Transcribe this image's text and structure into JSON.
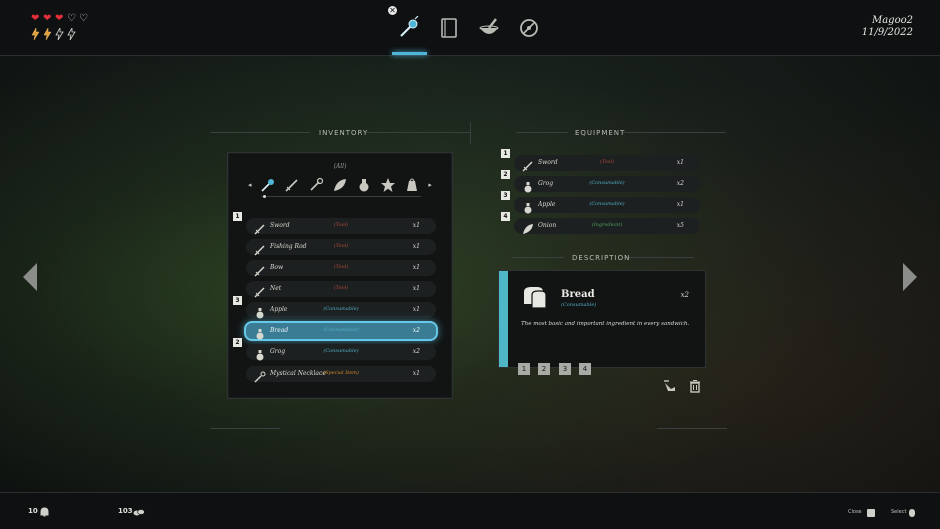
{
  "player": {
    "name": "Magoo2",
    "date": "11/9/2022"
  },
  "hud": {
    "hearts": [
      "full",
      "full",
      "full",
      "empty",
      "empty"
    ],
    "energy": [
      "full",
      "full",
      "empty",
      "empty"
    ]
  },
  "tabs": [
    {
      "id": "inventory",
      "icon": "potion-wand-icon",
      "active": true
    },
    {
      "id": "journal",
      "icon": "book-icon",
      "active": false
    },
    {
      "id": "crafting",
      "icon": "mortar-pestle-icon",
      "active": false
    },
    {
      "id": "settings",
      "icon": "compass-icon",
      "active": false
    }
  ],
  "inventory": {
    "title": "INVENTORY",
    "filter_label": "(All)",
    "items": [
      {
        "name": "Sword",
        "type": "(Tool)",
        "type_class": "tool",
        "qty": "x1",
        "slot": "1",
        "icon": "sword-icon"
      },
      {
        "name": "Fishing Rod",
        "type": "(Tool)",
        "type_class": "tool",
        "qty": "x1",
        "slot": "",
        "icon": "sword-icon"
      },
      {
        "name": "Bow",
        "type": "(Tool)",
        "type_class": "tool",
        "qty": "x1",
        "slot": "",
        "icon": "sword-icon"
      },
      {
        "name": "Net",
        "type": "(Tool)",
        "type_class": "tool",
        "qty": "x1",
        "slot": "",
        "icon": "sword-icon"
      },
      {
        "name": "Apple",
        "type": "(Consumable)",
        "type_class": "cons",
        "qty": "x1",
        "slot": "3",
        "icon": "potion-icon"
      },
      {
        "name": "Bread",
        "type": "(Consumable)",
        "type_class": "cons",
        "qty": "x2",
        "slot": "",
        "icon": "potion-icon",
        "selected": true
      },
      {
        "name": "Grog",
        "type": "(Consumable)",
        "type_class": "cons",
        "qty": "x2",
        "slot": "2",
        "icon": "potion-icon"
      },
      {
        "name": "Mystical Necklace",
        "type": "(Special Item)",
        "type_class": "spec",
        "qty": "x1",
        "slot": "",
        "icon": "wand-icon"
      }
    ]
  },
  "equipment": {
    "title": "EQUIPMENT",
    "items": [
      {
        "slot": "1",
        "name": "Sword",
        "type": "(Tool)",
        "type_class": "tool",
        "qty": "x1",
        "icon": "sword-icon"
      },
      {
        "slot": "2",
        "name": "Grog",
        "type": "(Consumable)",
        "type_class": "cons",
        "qty": "x2",
        "icon": "potion-icon"
      },
      {
        "slot": "3",
        "name": "Apple",
        "type": "(Consumable)",
        "type_class": "cons",
        "qty": "x1",
        "icon": "potion-icon"
      },
      {
        "slot": "4",
        "name": "Onion",
        "type": "(Ingredient)",
        "type_class": "ing",
        "qty": "x5",
        "icon": "leaf-icon"
      }
    ]
  },
  "description": {
    "title": "DESCRIPTION",
    "name": "Bread",
    "type": "(Consumable)",
    "qty": "x2",
    "text": "The most basic and important ingredient in every sandwich.",
    "hotkeys": [
      "1",
      "2",
      "3",
      "4"
    ]
  },
  "bottom": {
    "count_left": "10",
    "count_right": "103",
    "close_label": "Close",
    "select_label": "Select"
  },
  "colors": {
    "accent": "#4fb6d8",
    "tool": "#b04a3a",
    "consumable": "#4fb0c8",
    "ingredient": "#4aa060",
    "special": "#d88a2a"
  }
}
